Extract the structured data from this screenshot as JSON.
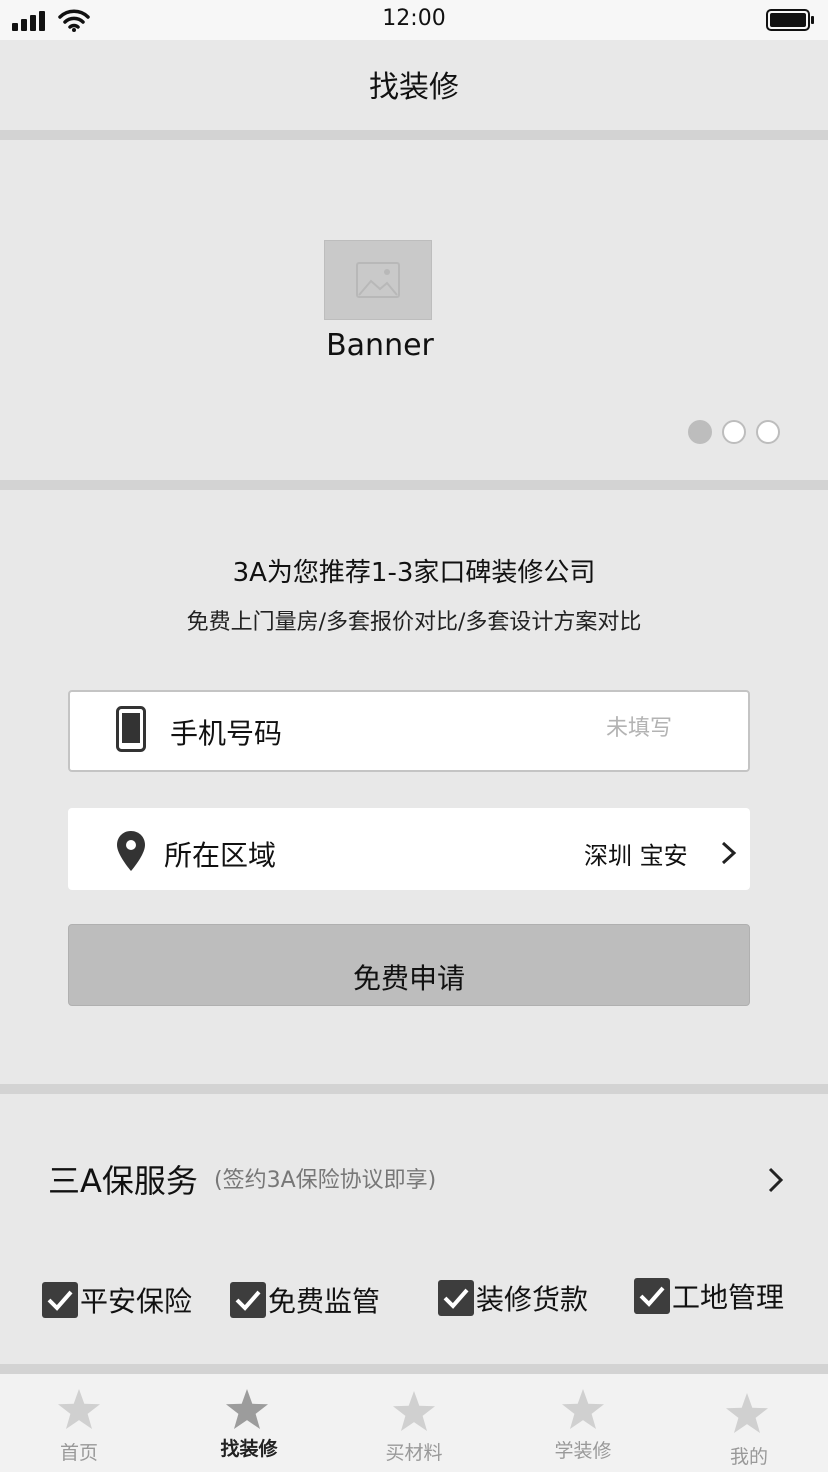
{
  "status_bar": {
    "time": "12:00"
  },
  "nav": {
    "title": "找装修"
  },
  "banner": {
    "label": "Banner",
    "dots": 3,
    "active_dot": 0
  },
  "form": {
    "headline": "3A为您推荐1-3家口碑装修公司",
    "subline": "免费上门量房/多套报价对比/多套设计方案对比",
    "phone": {
      "label": "手机号码",
      "placeholder": "未填写"
    },
    "region": {
      "label": "所在区域",
      "value": "深圳 宝安"
    },
    "submit_label": "免费申请"
  },
  "service": {
    "title": "三A保服务",
    "subtitle": "(签约3A保险协议即享)",
    "items": [
      {
        "label": "平安保险",
        "checked": true
      },
      {
        "label": "免费监管",
        "checked": true
      },
      {
        "label": "装修货款",
        "checked": true
      },
      {
        "label": "工地管理",
        "checked": true
      }
    ]
  },
  "tabs": [
    {
      "label": "首页",
      "active": false
    },
    {
      "label": "找装修",
      "active": true
    },
    {
      "label": "买材料",
      "active": false
    },
    {
      "label": "学装修",
      "active": false
    },
    {
      "label": "我的",
      "active": false
    }
  ],
  "colors": {
    "active_tab": "#222222",
    "inactive_tab": "#999999",
    "check": "#3d3d3d"
  }
}
